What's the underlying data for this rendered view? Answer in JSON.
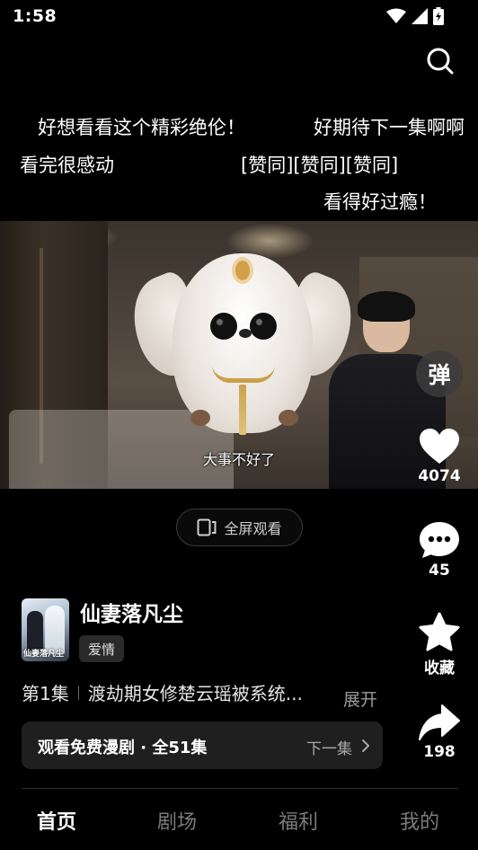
{
  "status_bar": {
    "time": "1:58"
  },
  "danmaku": [
    "好想看看这个精彩绝伦！",
    "好期待下一集啊啊",
    "看完很感动",
    "[赞同][赞同][赞同]",
    "看得好过瘾！"
  ],
  "video": {
    "subtitle": "大事不好了"
  },
  "fullscreen_button": {
    "label": "全屏观看"
  },
  "side_actions": {
    "danmu_toggle": "弹",
    "likes": "4074",
    "comments": "45",
    "favorite": "收藏",
    "shares": "198"
  },
  "drama": {
    "cover_text": "仙妻落凡尘",
    "title": "仙妻落凡尘",
    "genre": "爱情",
    "episode": "第1集",
    "synopsis": "渡劫期女修楚云瑶被系统...",
    "expand": "展开"
  },
  "watch_bar": {
    "label": "观看免费漫剧 · 全51集",
    "next": "下一集"
  },
  "tabs": [
    "首页",
    "剧场",
    "福利",
    "我的"
  ],
  "colors": {
    "background": "#000000",
    "inactive_tab": "#7b7b7b",
    "card": "#1f1f1f"
  }
}
